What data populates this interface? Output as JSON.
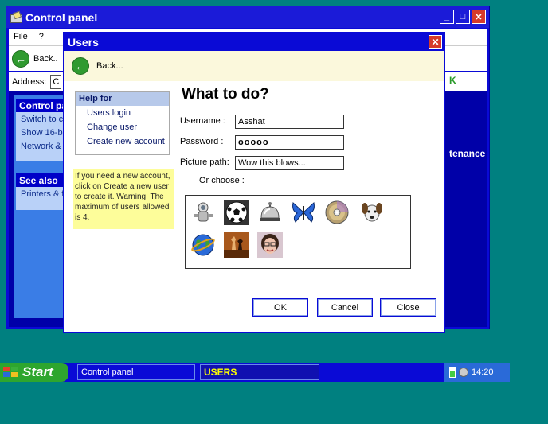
{
  "control_panel": {
    "title": "Control panel",
    "menu": [
      "File",
      "?"
    ],
    "back_label": "Back..",
    "address_label": "Address:",
    "address_value": "C",
    "ok_fragment": "K",
    "maintenance_fragment": "tenance",
    "side_panels": [
      {
        "header": "Control pa",
        "items": [
          "Switch to c",
          "Show 16-b",
          "Network &"
        ]
      },
      {
        "header": "See also",
        "items": [
          "Printers & f"
        ]
      }
    ]
  },
  "dialog": {
    "title": "Users",
    "back_label": "Back...",
    "help": {
      "header": "Help for",
      "links": [
        "Users login",
        "Change user",
        "Create new account"
      ]
    },
    "warning": "If you need a new account, click on Create a new user to create it. Warning: The maximum of users allowed is 4.",
    "heading": "What to do?",
    "username_label": "Username :",
    "username_value": "Asshat",
    "password_label": "Password :",
    "password_value": "ooooo",
    "picture_label": "Picture path:",
    "picture_value": "Wow this blows...",
    "or_choose": "Or choose :",
    "pictures": [
      "astronaut",
      "soccer-ball",
      "service-bell",
      "butterfly",
      "cd-disc",
      "dog",
      "earth-globe",
      "chess-pieces",
      "woman-face"
    ],
    "buttons": {
      "ok": "OK",
      "cancel": "Cancel",
      "close": "Close"
    }
  },
  "taskbar": {
    "start_label": "Start",
    "tasks": [
      "Control panel",
      "USERS"
    ],
    "clock": "14:20"
  },
  "colors": {
    "desktop": "#008080",
    "window_blue": "#0a0ad6",
    "close_red": "#d63a2a",
    "start_green": "#2ea62e",
    "active_task_text": "#ffff00",
    "help_note_yellow": "#fdfd9a"
  }
}
